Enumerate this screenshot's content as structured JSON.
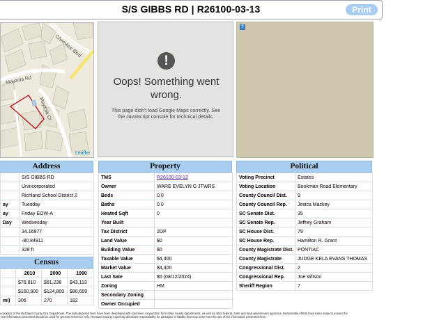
{
  "header": {
    "title": "S/S GIBBS RD | R26100-03-13",
    "print_label": "Print"
  },
  "map_left": {
    "labels": [
      "Cherokee Blvd",
      "Mayzola Rd",
      "Mayzola Ct"
    ],
    "attribution": "Leaflet"
  },
  "map_error": {
    "title": "Oops! Something went wrong.",
    "message": "This page didn't load Google Maps correctly. See the JavaScript console for technical details.",
    "icon": "!"
  },
  "map_right": {
    "help_icon": "?"
  },
  "address": {
    "heading": "Address",
    "rows": [
      {
        "key": "",
        "value": "S/S GIBBS RD"
      },
      {
        "key": "",
        "value": "Unincorporated"
      },
      {
        "key": "",
        "value": "Richland School District 2"
      },
      {
        "key": "ay",
        "value": "Tuesday"
      },
      {
        "key": "ay",
        "value": "Friday EOW-A"
      },
      {
        "key": "Day",
        "value": "Wednesday"
      },
      {
        "key": "",
        "value": "34.16977"
      },
      {
        "key": "",
        "value": "-80.84911"
      },
      {
        "key": "",
        "value": "328 ft"
      }
    ]
  },
  "census": {
    "heading": "Census",
    "years": [
      "2010",
      "2000",
      "1990"
    ],
    "rows": [
      {
        "key": "",
        "values": [
          "$76,810",
          "$61,238",
          "$43,113"
        ]
      },
      {
        "key": "",
        "values": [
          "$160,900",
          "$124,800",
          "$80,600"
        ]
      },
      {
        "key": "mi)",
        "values": [
          "306",
          "270",
          "182"
        ]
      }
    ]
  },
  "property": {
    "heading": "Property",
    "rows": [
      {
        "key": "TMS",
        "value": "R26100-03-13",
        "link": true
      },
      {
        "key": "Owner",
        "value": "WARE EVELYN G JTWRS"
      },
      {
        "key": "Beds",
        "value": "0.0"
      },
      {
        "key": "Baths",
        "value": "0.0"
      },
      {
        "key": "Heated Sqft",
        "value": "0"
      },
      {
        "key": "Year Built",
        "value": ""
      },
      {
        "key": "Tax District",
        "value": "2DP"
      },
      {
        "key": "Land Value",
        "value": "$0"
      },
      {
        "key": "Building Value",
        "value": "$0"
      },
      {
        "key": "Taxable Value",
        "value": "$4,400"
      },
      {
        "key": "Market Value",
        "value": "$4,400"
      },
      {
        "key": "Last Sale",
        "value": "$5 (08/12/2024)"
      },
      {
        "key": "Zoning",
        "value": "HM"
      },
      {
        "key": "Secondary Zoning",
        "value": ""
      },
      {
        "key": "Owner Occupied",
        "value": ""
      }
    ]
  },
  "political": {
    "heading": "Political",
    "rows": [
      {
        "key": "Voting Precinct",
        "value": "Estates"
      },
      {
        "key": "Voting Location",
        "value": "Bookman Road Elementary"
      },
      {
        "key": "County Council Dist.",
        "value": "9"
      },
      {
        "key": "County Council Rep.",
        "value": "Jesica Mackey"
      },
      {
        "key": "SC Senate Dist.",
        "value": "35"
      },
      {
        "key": "SC Senate Rep.",
        "value": "Jeffrey Graham"
      },
      {
        "key": "SC House Dist.",
        "value": "79"
      },
      {
        "key": "SC House Rep.",
        "value": "Hamilton R. Grant"
      },
      {
        "key": "County Magistrate Dist.",
        "value": "PONTIAC"
      },
      {
        "key": "County Magistrate",
        "value": "JUDGE KELA EVANS THOMAS"
      },
      {
        "key": "Congressional Dist.",
        "value": "2"
      },
      {
        "key": "Congressional Rep.",
        "value": "Joe Wilson"
      },
      {
        "key": "Sheriff Region",
        "value": "7"
      }
    ]
  },
  "footer": {
    "line1": "a product of the Richland County GIS Department. The data depicted here have been developed with extensive cooperation from other county departments, as well as other federal, state and local government agencies. Reasonable efforts have been made to ensure the",
    "line2": "; the information presented should be used for general reference only. Richland County expressly disclaims responsibility for damages or liability that may arise from the use of the information presented here."
  }
}
